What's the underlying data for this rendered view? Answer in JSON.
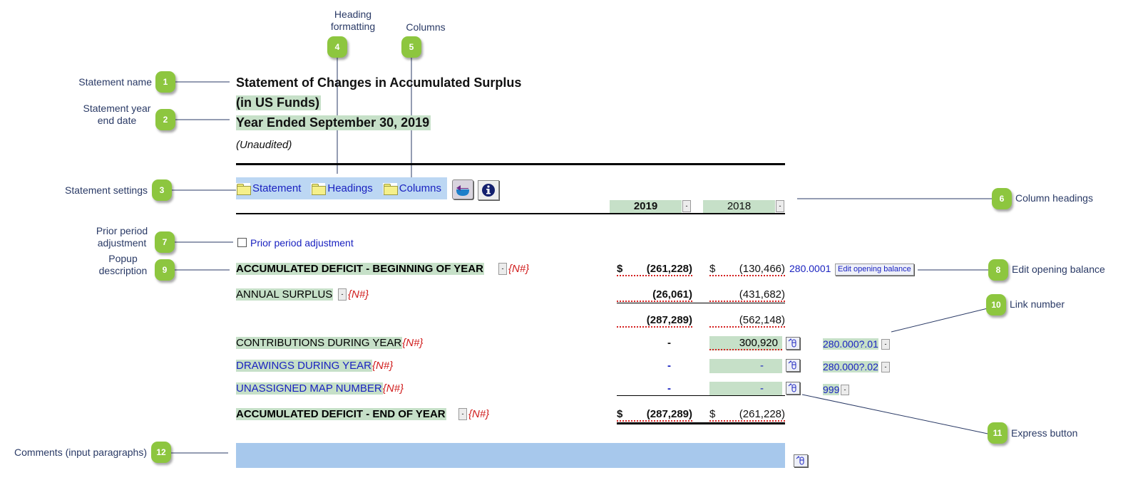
{
  "callouts": [
    {
      "number": "1",
      "label": "Statement name"
    },
    {
      "number": "2",
      "label": "Statement year\nend date"
    },
    {
      "number": "3",
      "label": "Statement settings"
    },
    {
      "number": "4",
      "label": "Heading\nformatting"
    },
    {
      "number": "5",
      "label": "Columns"
    },
    {
      "number": "6",
      "label": "Column headings"
    },
    {
      "number": "7",
      "label": "Prior period\nadjustment"
    },
    {
      "number": "8",
      "label": "Edit opening balance"
    },
    {
      "number": "9",
      "label": "Popup\ndescription"
    },
    {
      "number": "10",
      "label": "Link number"
    },
    {
      "number": "11",
      "label": "Express button"
    },
    {
      "number": "12",
      "label": "Comments (input paragraphs)"
    }
  ],
  "statement": {
    "name": "Statement of Changes in Accumulated Surplus",
    "currency": "(in US Funds)",
    "year_end": "Year Ended September 30, 2019",
    "status": "(Unaudited)"
  },
  "toolbar": {
    "items": [
      {
        "label": "Statement",
        "icon": "folder-icon"
      },
      {
        "label": "Headings",
        "icon": "folder-icon"
      },
      {
        "label": "Columns",
        "icon": "folder-icon"
      }
    ],
    "refresh_icon": "refresh-icon",
    "info_icon": "info-icon"
  },
  "columns": [
    {
      "heading": "2019",
      "dropdown": "-"
    },
    {
      "heading": "2018",
      "dropdown": "-"
    }
  ],
  "prior_period": {
    "label": "Prior period adjustment",
    "checked": false
  },
  "rows": [
    {
      "label": "ACCUMULATED DEFICIT - BEGINNING OF YEAR",
      "tag": "{N#}",
      "dollar": "$",
      "c2019": "(261,228)",
      "c2018": "(130,466)",
      "link": "280.0001",
      "action": "Edit opening balance"
    },
    {
      "label": "ANNUAL SURPLUS",
      "tag": "{N#}",
      "c2019": "(26,061)",
      "c2018": "(431,682)"
    },
    {
      "label": "",
      "c2019": "(287,289)",
      "c2018": "(562,148)"
    },
    {
      "label": "CONTRIBUTIONS DURING YEAR",
      "tag": "{N#}",
      "c2019": "-",
      "c2018": "300,920",
      "link": "280.000?.01"
    },
    {
      "label": "DRAWINGS DURING YEAR",
      "tag": "{N#}",
      "c2019": "-",
      "c2018": "-",
      "link": "280.000?.02"
    },
    {
      "label": "UNASSIGNED MAP NUMBER",
      "tag": "{N#}",
      "c2019": "-",
      "c2018": "-",
      "link": "999"
    },
    {
      "label": "ACCUMULATED DEFICIT - END OF YEAR",
      "tag": "{N#}",
      "dollar": "$",
      "c2019": "(287,289)",
      "c2018": "(261,228)"
    }
  ],
  "dropdown_glyph": "-",
  "colors": {
    "badge": "#8dc63f",
    "callout_text": "#2a3a66",
    "highlight": "#c6e0c8",
    "toolbar_bg": "#bcd7f3",
    "comments_bg": "#a7c8ec",
    "link_blue": "#1a22c0",
    "tag_red": "#d01c1c"
  }
}
